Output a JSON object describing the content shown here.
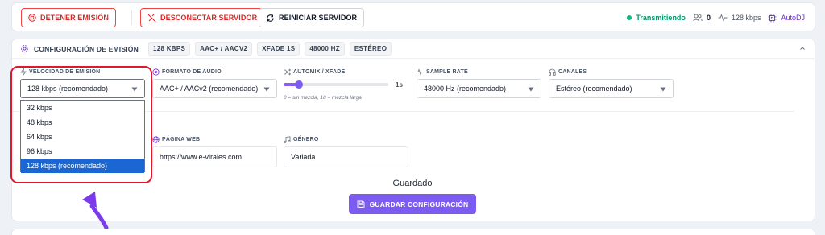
{
  "toolbar": {
    "stop_label": "DETENER EMISIÓN",
    "disconnect_label": "DESCONECTAR SERVIDOR",
    "restart_label": "REINICIAR SERVIDOR"
  },
  "status": {
    "state": "Transmitiendo",
    "listeners": "0",
    "bitrate": "128 kbps",
    "mode": "AutoDJ"
  },
  "config": {
    "title": "CONFIGURACIÓN DE EMISIÓN",
    "chips": [
      "128 KBPS",
      "AAC+ / AACV2",
      "XFADE 1S",
      "48000 HZ",
      "ESTÉREO"
    ]
  },
  "fields": {
    "bitrate": {
      "label": "VELOCIDAD DE EMISIÓN",
      "value": "128 kbps (recomendado)"
    },
    "format": {
      "label": "FORMATO DE AUDIO",
      "value": "AAC+ / AACv2 (recomendado)"
    },
    "xfade": {
      "label": "AUTOMIX / XFADE",
      "value": "1s",
      "hint": "0 = sin mezcla, 10 = mezcla larga",
      "level": 1,
      "max": 10
    },
    "samplerate": {
      "label": "SAMPLE RATE",
      "value": "48000 Hz (recomendado)"
    },
    "channels": {
      "label": "CANALES",
      "value": "Estéreo (recomendado)"
    },
    "website": {
      "label": "PÁGINA WEB",
      "value": "https://www.e-virales.com"
    },
    "genre": {
      "label": "GÉNERO",
      "value": "Variada"
    }
  },
  "dropdown": {
    "options": [
      "32 kbps",
      "48 kbps",
      "64 kbps",
      "96 kbps",
      "128 kbps (recomendado)"
    ],
    "selected_index": 4
  },
  "footer": {
    "saved_text": "Guardado",
    "save_label": "GUARDAR CONFIGURACIÓN"
  },
  "colors": {
    "accent": "#7c5cf0",
    "danger": "#dc2626",
    "live": "#10b981",
    "selection": "#1a66d2",
    "highlight": "#e0182d"
  }
}
